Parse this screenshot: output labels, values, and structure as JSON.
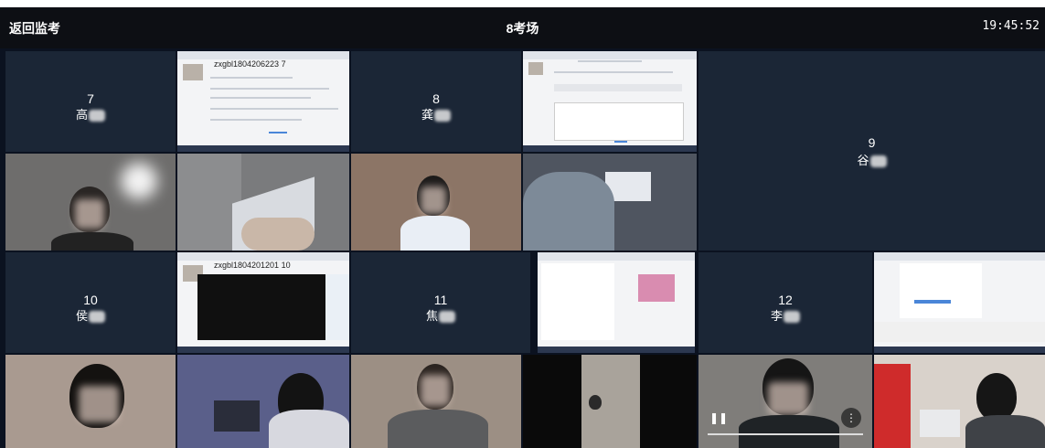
{
  "header": {
    "back_label": "返回监考",
    "title": "8考场",
    "time": "19:45:52"
  },
  "students": [
    {
      "number": "7",
      "name": "高"
    },
    {
      "number": "8",
      "name": "龚"
    },
    {
      "number": "9",
      "name": "谷"
    },
    {
      "number": "10",
      "name": "侯"
    },
    {
      "number": "11",
      "name": "焦"
    },
    {
      "number": "12",
      "name": "李"
    }
  ],
  "screens": [
    {
      "id": "zxgbl1804206223 7"
    },
    {
      "id": ""
    },
    {
      "id": "zxgbl1804201201 10"
    },
    {
      "id": ""
    },
    {
      "id": ""
    }
  ],
  "player": {
    "pause_icon": "pause-icon",
    "more_icon": "more-vertical-icon"
  },
  "colors": {
    "background": "#0b1220",
    "name_tile": "#1b2636",
    "topbar": "#0d0f14"
  }
}
